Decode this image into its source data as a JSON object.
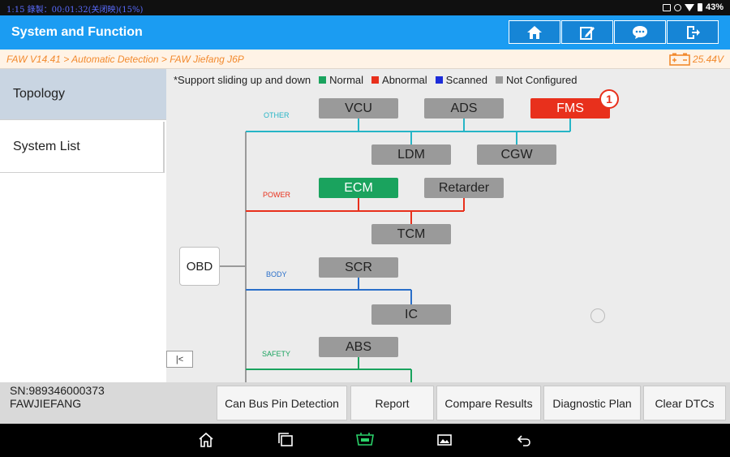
{
  "status_bar": {
    "time": "1:15",
    "recording": "錄製：00:01:32(关闭映)(15%)",
    "battery": "43%"
  },
  "header": {
    "title": "System and Function",
    "buttons": [
      {
        "name": "home-button",
        "icon": "home-icon"
      },
      {
        "name": "edit-button",
        "icon": "edit-icon"
      },
      {
        "name": "feedback-button",
        "icon": "chat-icon"
      },
      {
        "name": "exit-button",
        "icon": "exit-icon"
      }
    ]
  },
  "breadcrumb": {
    "path": "FAW V14.41 > Automatic Detection > FAW Jiefang J6P",
    "voltage": "25.44V"
  },
  "sidebar": {
    "items": [
      {
        "label": "Topology",
        "active": true
      },
      {
        "label": "System List",
        "active": false
      }
    ]
  },
  "topology": {
    "hint": "*Support sliding up and down",
    "legend": [
      {
        "label": "Normal",
        "color": "#1aa35e"
      },
      {
        "label": "Abnormal",
        "color": "#e8301c"
      },
      {
        "label": "Scanned",
        "color": "#1c2cd9"
      },
      {
        "label": "Not Configured",
        "color": "#9a9a9a"
      }
    ],
    "root": "OBD",
    "groups": [
      {
        "label": "OTHER",
        "color": "#26b5c6"
      },
      {
        "label": "POWER",
        "color": "#e8301c"
      },
      {
        "label": "BODY",
        "color": "#2a6fc9"
      },
      {
        "label": "SAFETY",
        "color": "#1aa35e"
      }
    ],
    "nodes": {
      "vcu": "VCU",
      "ads": "ADS",
      "fms": "FMS",
      "fms_dtc_count": "1",
      "ldm": "LDM",
      "cgw": "CGW",
      "ecm": "ECM",
      "retarder": "Retarder",
      "tcm": "TCM",
      "scr": "SCR",
      "ic": "IC",
      "abs": "ABS"
    }
  },
  "footer": {
    "sn": "SN:989346000373",
    "vehicle": "FAWJIEFANG",
    "buttons": [
      "Can Bus Pin Detection",
      "Report",
      "Compare Results",
      "Diagnostic Plan",
      "Clear DTCs"
    ]
  }
}
